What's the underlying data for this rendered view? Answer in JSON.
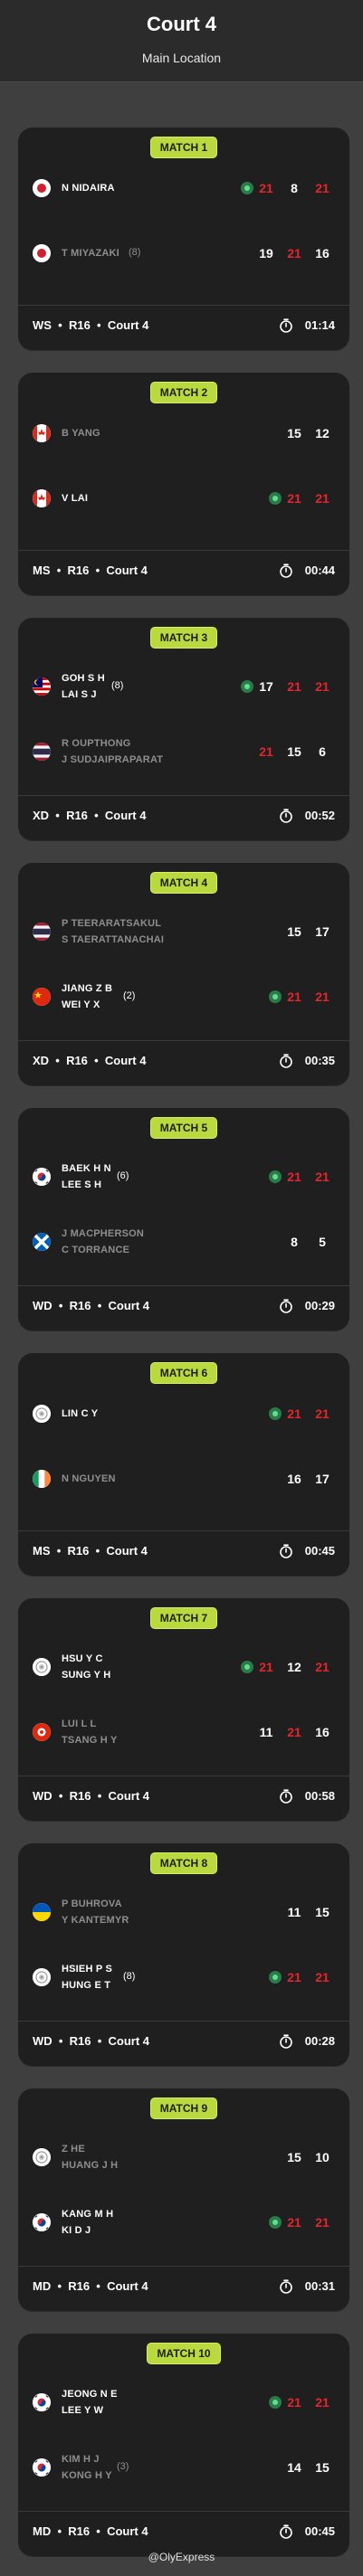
{
  "header": {
    "title": "Court 4",
    "subtitle": "Main Location"
  },
  "colors": {
    "badge": "#b9d93e",
    "win_score": "#e2262c",
    "serve_dot": "#3ccf78",
    "card": "#1f1f1f",
    "background": "#3f3f3f"
  },
  "matches": [
    {
      "label": "MATCH 1",
      "event": "WS",
      "round": "R16",
      "court": "Court 4",
      "duration": "01:14",
      "winner_team": 0,
      "server_team": 0,
      "teams": [
        {
          "flag": "japan-flag",
          "players": [
            "N NIDAIRA"
          ],
          "seed": ""
        },
        {
          "flag": "japan-flag",
          "players": [
            "T MIYAZAKI"
          ],
          "seed": "(8)"
        }
      ],
      "scores": [
        [
          "21",
          "8",
          "21"
        ],
        [
          "19",
          "21",
          "16"
        ]
      ],
      "score_red": [
        [
          true,
          false,
          true
        ],
        [
          false,
          true,
          false
        ]
      ]
    },
    {
      "label": "MATCH 2",
      "event": "MS",
      "round": "R16",
      "court": "Court 4",
      "duration": "00:44",
      "winner_team": 1,
      "server_team": 1,
      "teams": [
        {
          "flag": "canada-flag",
          "players": [
            "B YANG"
          ],
          "seed": ""
        },
        {
          "flag": "canada-flag",
          "players": [
            "V LAI"
          ],
          "seed": ""
        }
      ],
      "scores": [
        [
          "15",
          "12"
        ],
        [
          "21",
          "21"
        ]
      ],
      "score_red": [
        [
          false,
          false
        ],
        [
          true,
          true
        ]
      ]
    },
    {
      "label": "MATCH 3",
      "event": "XD",
      "round": "R16",
      "court": "Court 4",
      "duration": "00:52",
      "winner_team": 0,
      "server_team": 0,
      "teams": [
        {
          "flag": "malaysia-flag",
          "players": [
            "GOH S H",
            "LAI S J"
          ],
          "seed": "(8)"
        },
        {
          "flag": "thailand-flag",
          "players": [
            "R OUPTHONG",
            "J SUDJAIPRAPARAT"
          ],
          "seed": ""
        }
      ],
      "scores": [
        [
          "17",
          "21",
          "21"
        ],
        [
          "21",
          "15",
          "6"
        ]
      ],
      "score_red": [
        [
          false,
          true,
          true
        ],
        [
          true,
          false,
          false
        ]
      ]
    },
    {
      "label": "MATCH 4",
      "event": "XD",
      "round": "R16",
      "court": "Court 4",
      "duration": "00:35",
      "winner_team": 1,
      "server_team": 1,
      "teams": [
        {
          "flag": "thailand-flag",
          "players": [
            "P TEERARATSAKUL",
            "S TAERATTANACHAI"
          ],
          "seed": ""
        },
        {
          "flag": "china-flag",
          "players": [
            "JIANG Z B",
            "WEI Y X"
          ],
          "seed": "(2)"
        }
      ],
      "scores": [
        [
          "15",
          "17"
        ],
        [
          "21",
          "21"
        ]
      ],
      "score_red": [
        [
          false,
          false
        ],
        [
          true,
          true
        ]
      ]
    },
    {
      "label": "MATCH 5",
      "event": "WD",
      "round": "R16",
      "court": "Court 4",
      "duration": "00:29",
      "winner_team": 0,
      "server_team": 0,
      "teams": [
        {
          "flag": "korea-flag",
          "players": [
            "BAEK H N",
            "LEE S H"
          ],
          "seed": "(6)"
        },
        {
          "flag": "scotland-flag",
          "players": [
            "J MACPHERSON",
            "C TORRANCE"
          ],
          "seed": ""
        }
      ],
      "scores": [
        [
          "21",
          "21"
        ],
        [
          "8",
          "5"
        ]
      ],
      "score_red": [
        [
          true,
          true
        ],
        [
          false,
          false
        ]
      ]
    },
    {
      "label": "MATCH 6",
      "event": "MS",
      "round": "R16",
      "court": "Court 4",
      "duration": "00:45",
      "winner_team": 0,
      "server_team": 0,
      "teams": [
        {
          "flag": "taipei-flag",
          "players": [
            "LIN C Y"
          ],
          "seed": ""
        },
        {
          "flag": "ireland-flag",
          "players": [
            "N NGUYEN"
          ],
          "seed": ""
        }
      ],
      "scores": [
        [
          "21",
          "21"
        ],
        [
          "16",
          "17"
        ]
      ],
      "score_red": [
        [
          true,
          true
        ],
        [
          false,
          false
        ]
      ]
    },
    {
      "label": "MATCH 7",
      "event": "WD",
      "round": "R16",
      "court": "Court 4",
      "duration": "00:58",
      "winner_team": 0,
      "server_team": 0,
      "teams": [
        {
          "flag": "taipei-flag",
          "players": [
            "HSU Y C",
            "SUNG Y H"
          ],
          "seed": ""
        },
        {
          "flag": "hongkong-flag",
          "players": [
            "LUI L L",
            "TSANG H Y"
          ],
          "seed": ""
        }
      ],
      "scores": [
        [
          "21",
          "12",
          "21"
        ],
        [
          "11",
          "21",
          "16"
        ]
      ],
      "score_red": [
        [
          true,
          false,
          true
        ],
        [
          false,
          true,
          false
        ]
      ]
    },
    {
      "label": "MATCH 8",
      "event": "WD",
      "round": "R16",
      "court": "Court 4",
      "duration": "00:28",
      "winner_team": 1,
      "server_team": 1,
      "teams": [
        {
          "flag": "ukraine-flag",
          "players": [
            "P BUHROVA",
            "Y KANTEMYR"
          ],
          "seed": ""
        },
        {
          "flag": "taipei-flag",
          "players": [
            "HSIEH P S",
            "HUNG E T"
          ],
          "seed": "(8)"
        }
      ],
      "scores": [
        [
          "11",
          "15"
        ],
        [
          "21",
          "21"
        ]
      ],
      "score_red": [
        [
          false,
          false
        ],
        [
          true,
          true
        ]
      ]
    },
    {
      "label": "MATCH 9",
      "event": "MD",
      "round": "R16",
      "court": "Court 4",
      "duration": "00:31",
      "winner_team": 1,
      "server_team": 1,
      "teams": [
        {
          "flag": "taipei-flag",
          "players": [
            "Z HE",
            "HUANG J H"
          ],
          "seed": ""
        },
        {
          "flag": "korea-flag",
          "players": [
            "KANG M H",
            "KI D J"
          ],
          "seed": ""
        }
      ],
      "scores": [
        [
          "15",
          "10"
        ],
        [
          "21",
          "21"
        ]
      ],
      "score_red": [
        [
          false,
          false
        ],
        [
          true,
          true
        ]
      ]
    },
    {
      "label": "MATCH 10",
      "event": "MD",
      "round": "R16",
      "court": "Court 4",
      "duration": "00:45",
      "winner_team": 0,
      "server_team": 0,
      "teams": [
        {
          "flag": "korea-flag",
          "players": [
            "JEONG N E",
            "LEE Y W"
          ],
          "seed": ""
        },
        {
          "flag": "korea-flag",
          "players": [
            "KIM H J",
            "KONG H Y"
          ],
          "seed": "(3)"
        }
      ],
      "scores": [
        [
          "21",
          "21"
        ],
        [
          "14",
          "15"
        ]
      ],
      "score_red": [
        [
          true,
          true
        ],
        [
          false,
          false
        ]
      ]
    }
  ],
  "watermark": "@OlyExpress"
}
